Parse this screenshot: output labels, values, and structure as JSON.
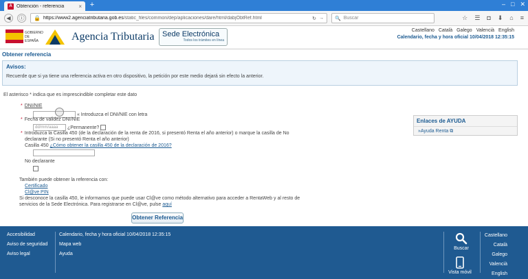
{
  "browser": {
    "tab_title": "Obtención - referencia",
    "tab_close": "×",
    "new_tab": "+",
    "url_host": "https://www2.agenciatributaria.gob.es",
    "url_path": "/static_files/common/dep/aplicaciones/dare/html/dabjObtRef.html",
    "search_placeholder": "Buscar"
  },
  "header": {
    "gob_text": "GOBIERNO DE ESPAÑA",
    "agency_name": "Agencia Tributaria",
    "sede_title": "Sede Electrónica",
    "sede_subtitle": "Todos los trámites en línea",
    "languages": [
      "Castellano",
      "Català",
      "Galego",
      "Valencià",
      "English"
    ],
    "calendar": "Calendario, fecha y hora oficial 10/04/2018 12:35:15"
  },
  "page_title": "Obtener referencia",
  "avisos": {
    "title": "Avisos:",
    "text": "Recuerde que si ya tiene una referencia activa en otro dispositivo, la petición por este medio dejará sin efecto la anterior."
  },
  "asterisk_note": "El asterisco * indica que es imprescindible completar este dato",
  "form": {
    "dni_label": "DNI/NIE",
    "dni_hint": "« Introduzca el DNI/NIE con letra",
    "fecha_label": "Fecha de validez DNI/NIE",
    "fecha_placeholder": "dd/mm/aaaa",
    "permanente_label": "¿Permanente?",
    "casilla_text_1": "Introduzca la Casilla 450 (de la declaración de la renta de 2016, si presentó Renta el año anterior) o marque la casilla de No",
    "casilla_text_2": "declarante (Si no presentó Renta el año anterior)",
    "casilla_label": "Casilla 450",
    "casilla_link": "¿Cómo obtener la casilla 450 de la declaración de 2016?",
    "no_declarante": "No declarante",
    "also_text": "También puede obtener la referencia con:",
    "certificado": "Certificado",
    "clave_pin": "Cl@ve PIN",
    "info_text_1": "Si desconoce la casilla 450, le informamos que puede usar Cl@ve como método alternativo para acceder a RentaWeb y al resto de",
    "info_text_2": "servicios de la Sede Electrónica. Para registrarse en Cl@ve, pulse",
    "info_link": "aquí",
    "submit": "Obtener Referencia"
  },
  "help": {
    "title": "Enlaces de AYUDA",
    "link": "»Ayuda Renta"
  },
  "footer": {
    "col1": [
      "Accesibilidad",
      "Aviso de seguridad",
      "Aviso legal"
    ],
    "col2": [
      "Calendario, fecha y hora oficial 10/04/2018 12:35:15",
      "Mapa web",
      "Ayuda"
    ],
    "search_label": "Buscar",
    "mobile_label": "Vista móvil",
    "languages": [
      "Castellano",
      "Català",
      "Galego",
      "Valencià",
      "English"
    ]
  },
  "colors": {
    "chrome_blue": "#2f7fd6",
    "brand_blue": "#1b5a91",
    "footer_blue": "#1f5a91",
    "required_red": "#c8102e"
  }
}
